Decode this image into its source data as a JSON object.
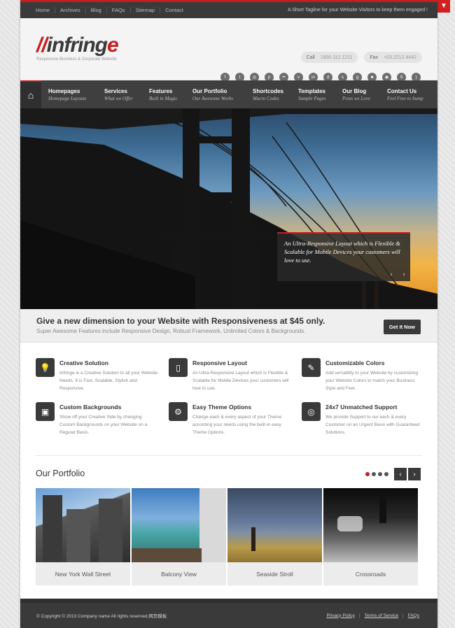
{
  "topbar": {
    "nav": [
      "Home",
      "Archives",
      "Blog",
      "FAQs",
      "Sitemap",
      "Contact"
    ],
    "tagline": "A Short Tagline for your Website Visitors to keep them engaged !"
  },
  "header": {
    "logo": "//infringe",
    "logo_sub": "Responsive Business & Corporate Website",
    "call_label": "Call",
    "call_value": "1800.112.1211",
    "fax_label": "Fax",
    "fax_value": "+03.2212.4442",
    "social_icons": [
      "facebook-icon",
      "twitter-icon",
      "dribbble-icon",
      "pinterest-icon",
      "flickr-icon",
      "vimeo-icon",
      "linkedin-icon",
      "deviantart-icon",
      "stumbleupon-icon",
      "digg-icon",
      "delicious-icon",
      "instagram-icon",
      "skype-icon",
      "rss-icon"
    ]
  },
  "nav": [
    {
      "title": "Homepages",
      "sub": "Homepage Layouts"
    },
    {
      "title": "Services",
      "sub": "What we Offer"
    },
    {
      "title": "Features",
      "sub": "Built in Magic"
    },
    {
      "title": "Our Portfolio",
      "sub": "Our Awesome Works"
    },
    {
      "title": "Shortcodes",
      "sub": "Macro Codes"
    },
    {
      "title": "Templates",
      "sub": "Sample Pages"
    },
    {
      "title": "Our Blog",
      "sub": "Posts we Love"
    },
    {
      "title": "Contact Us",
      "sub": "Feel Free to bump"
    }
  ],
  "hero": {
    "caption": "An Ultra-Responsive Layout which is Flexible & Scalable for Mobile Devices your customers will love to use."
  },
  "callout": {
    "heading": "Give a new dimension to your Website with Responsiveness at $45 only.",
    "sub": "Super Awesome Features include Responsive Design, Robust Framework, Unlimited Colors & Backgrounds.",
    "button": "Get It Now"
  },
  "features": [
    {
      "title": "Creative Solution",
      "text": "Infringe is a Creative Solution to all your Website Needs. It is Fast, Scalable, Stylish and Responsive.",
      "icon": "lightbulb-icon"
    },
    {
      "title": "Responsive Layout",
      "text": "An Ultra-Responsive Layout which is Flexible & Scalable for Mobile Devices your customers will love to use.",
      "icon": "mobile-icon"
    },
    {
      "title": "Customizable Colors",
      "text": "Add versatility to your Website by customizing your Website Colors to match your Business Style and Feel.",
      "icon": "brush-icon"
    },
    {
      "title": "Custom Backgrounds",
      "text": "Show off your Creative Side by changing Custom Backgrounds on your Website on a Regular Basis.",
      "icon": "picture-icon"
    },
    {
      "title": "Easy Theme Options",
      "text": "Change each & every aspect of your Theme according your needs using the built-in easy Theme Options.",
      "icon": "gear-icon"
    },
    {
      "title": "24x7 Unmatched Support",
      "text": "We provide Support to our each & every Customer on an Urgent Basis with Guaranteed Solutions.",
      "icon": "lifebuoy-icon"
    }
  ],
  "portfolio": {
    "title": "Our Portfolio",
    "items": [
      "New York Wall Street",
      "Balcony View",
      "Seaside Stroll",
      "Crossroads"
    ]
  },
  "footer": {
    "copyright": "© Copyright © 2013 Company name All rights reserved.网页模板",
    "links": [
      "Privacy Policy",
      "Terms of Service",
      "FAQs"
    ]
  }
}
